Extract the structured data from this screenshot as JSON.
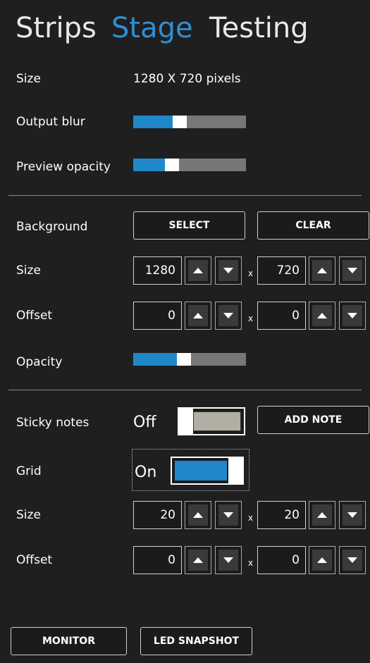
{
  "tabs": [
    {
      "label": "Strips",
      "active": false
    },
    {
      "label": "Stage",
      "active": true
    },
    {
      "label": "Testing",
      "active": false
    }
  ],
  "stage": {
    "size_label": "Size",
    "size_value": "1280  X  720  pixels",
    "output_blur_label": "Output blur",
    "output_blur_level": 0.4,
    "preview_opacity_label": "Preview opacity",
    "preview_opacity_level": 0.32
  },
  "background": {
    "label": "Background",
    "select_label": "SELECT",
    "clear_label": "CLEAR",
    "size_label": "Size",
    "width": "1280",
    "height": "720",
    "offset_label": "Offset",
    "offset_x": "0",
    "offset_y": "0",
    "opacity_label": "Opacity",
    "opacity_level": 0.44,
    "times": "x"
  },
  "sticky": {
    "label": "Sticky notes",
    "state_text": "Off",
    "add_note_label": "ADD NOTE"
  },
  "grid": {
    "label": "Grid",
    "state_text": "On",
    "size_label": "Size",
    "size_x": "20",
    "size_y": "20",
    "offset_label": "Offset",
    "offset_x": "0",
    "offset_y": "0",
    "times": "x"
  },
  "footer": {
    "monitor_label": "MONITOR",
    "led_snapshot_label": "LED SNAPSHOT"
  },
  "colors": {
    "accent": "#1e88c8",
    "active_tab": "#2f8fd1",
    "toggle_off": "#b3aea4",
    "slider_track": "#777777",
    "background": "#1f1f1f"
  }
}
